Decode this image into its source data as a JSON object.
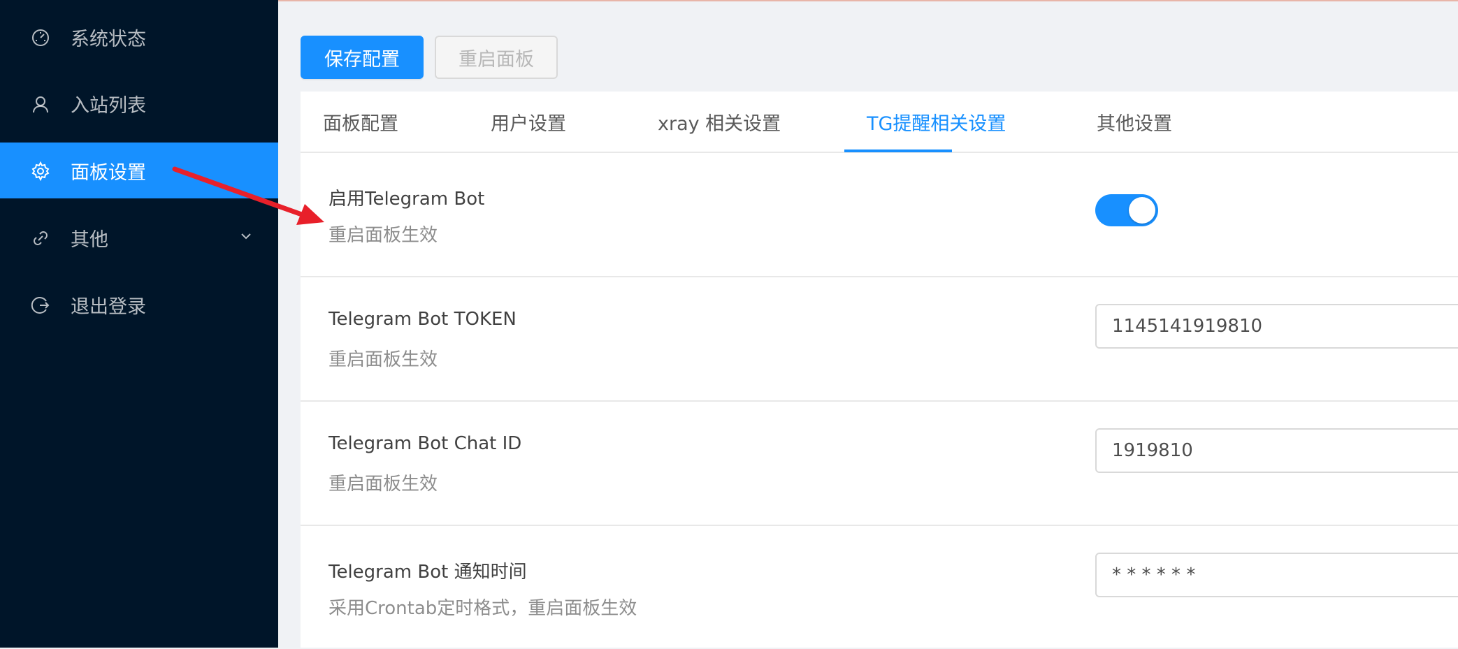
{
  "sidebar": {
    "items": [
      {
        "label": "系统状态",
        "icon": "dashboard-icon"
      },
      {
        "label": "入站列表",
        "icon": "user-icon"
      },
      {
        "label": "面板设置",
        "icon": "gear-icon"
      },
      {
        "label": "其他",
        "icon": "link-icon"
      },
      {
        "label": "退出登录",
        "icon": "logout-icon"
      }
    ],
    "active_index": 2
  },
  "toolbar": {
    "save_label": "保存配置",
    "restart_label": "重启面板"
  },
  "tabs": [
    {
      "label": "面板配置"
    },
    {
      "label": "用户设置"
    },
    {
      "label": "xray 相关设置"
    },
    {
      "label": "TG提醒相关设置"
    },
    {
      "label": "其他设置"
    }
  ],
  "active_tab": 3,
  "settings": [
    {
      "title": "启用Telegram Bot",
      "desc": "重启面板生效",
      "type": "switch",
      "checked": true
    },
    {
      "title": "Telegram Bot TOKEN",
      "desc": "重启面板生效",
      "type": "input",
      "value": "1145141919810"
    },
    {
      "title": "Telegram Bot Chat ID",
      "desc": "重启面板生效",
      "type": "input",
      "value": "1919810"
    },
    {
      "title": "Telegram Bot 通知时间",
      "desc": "采用Crontab定时格式，重启面板生效",
      "type": "input",
      "value": "* * * * * *"
    }
  ],
  "colors": {
    "sidebar_bg": "#001529",
    "accent": "#1890ff",
    "annotation": "#e8202a"
  }
}
